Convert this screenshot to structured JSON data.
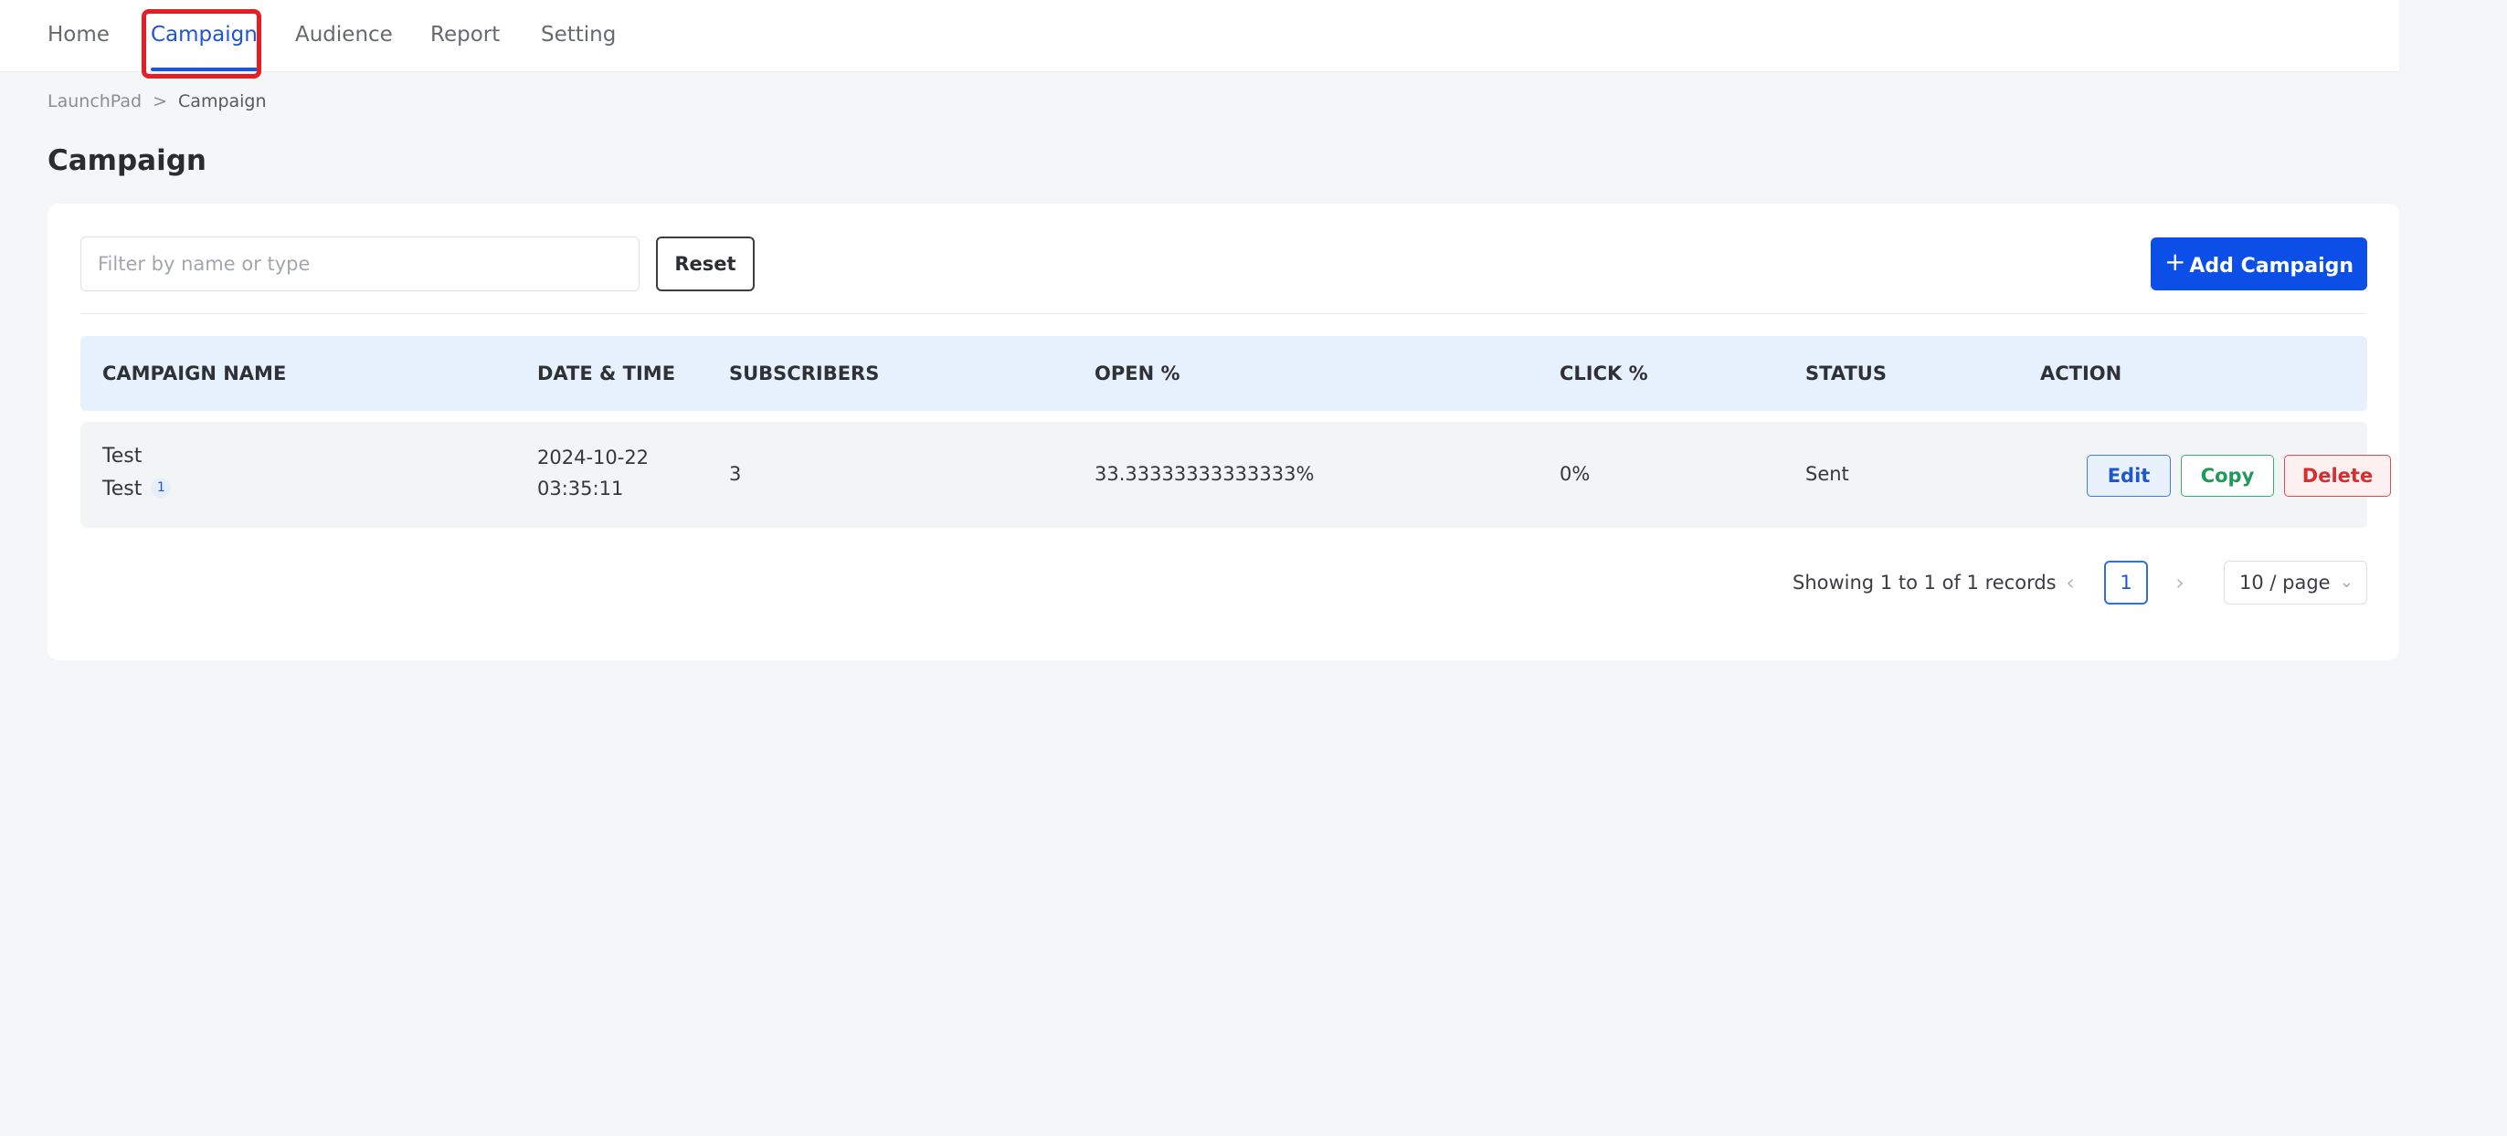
{
  "nav": {
    "items": [
      {
        "label": "Home"
      },
      {
        "label": "Campaign"
      },
      {
        "label": "Audience"
      },
      {
        "label": "Report"
      },
      {
        "label": "Setting"
      }
    ],
    "active_index": 1
  },
  "breadcrumb": {
    "root": "LaunchPad",
    "separator": ">",
    "current": "Campaign"
  },
  "page": {
    "title": "Campaign"
  },
  "toolbar": {
    "filter_placeholder": "Filter by name or type",
    "filter_value": "",
    "reset_label": "Reset",
    "add_label": "Add Campaign",
    "add_icon": "+"
  },
  "table": {
    "headers": [
      "CAMPAIGN NAME",
      "DATE & TIME",
      "SUBSCRIBERS",
      "OPEN %",
      "CLICK %",
      "STATUS",
      "ACTION"
    ],
    "rows": [
      {
        "name": "Test",
        "type": "Test",
        "type_count": "1",
        "date": "2024-10-22",
        "time": "03:35:11",
        "subscribers": "3",
        "open_pct": "33.33333333333333%",
        "click_pct": "0%",
        "status": "Sent",
        "actions": {
          "edit": "Edit",
          "copy": "Copy",
          "delete": "Delete"
        }
      }
    ]
  },
  "pagination": {
    "summary": "Showing 1 to 1 of 1 records",
    "prev_icon": "‹",
    "next_icon": "›",
    "current_page": "1",
    "page_size": "10 / page",
    "page_size_icon": "⌄"
  },
  "colors": {
    "accent": "#0b4fe8",
    "active_nav": "#1e54d6",
    "highlight": "#e31e24",
    "header_bg": "#e7f1fd"
  }
}
